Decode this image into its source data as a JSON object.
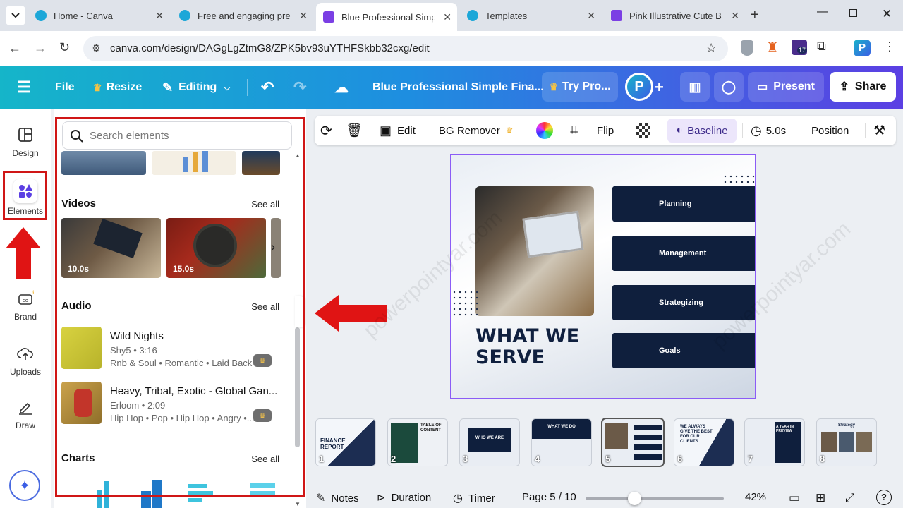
{
  "browser": {
    "tabs": [
      {
        "title": "Home - Canva",
        "active": false
      },
      {
        "title": "Free and engaging prese",
        "active": false
      },
      {
        "title": "Blue Professional Simple",
        "active": true
      },
      {
        "title": "Templates",
        "active": false
      },
      {
        "title": "Pink Illustrative Cute Bra",
        "active": false
      }
    ],
    "url": "canva.com/design/DAGgLgZtmG8/ZPK5bv93uYTHFSkbb32cxg/edit",
    "extension_badge": "17"
  },
  "header": {
    "file_label": "File",
    "resize_label": "Resize",
    "editing_label": "Editing",
    "doc_title": "Blue Professional Simple Fina...",
    "try_pro_label": "Try Pro...",
    "present_label": "Present",
    "share_label": "Share"
  },
  "rail": {
    "items": [
      {
        "label": "Design",
        "icon": "design-icon"
      },
      {
        "label": "Elements",
        "icon": "elements-icon"
      },
      {
        "label": "Brand",
        "icon": "brand-icon"
      },
      {
        "label": "Uploads",
        "icon": "uploads-icon"
      },
      {
        "label": "Draw",
        "icon": "draw-icon"
      }
    ]
  },
  "panel": {
    "search_placeholder": "Search elements",
    "videos": {
      "heading": "Videos",
      "see_all": "See all",
      "items": [
        {
          "duration": "10.0s"
        },
        {
          "duration": "15.0s"
        }
      ]
    },
    "audio": {
      "heading": "Audio",
      "see_all": "See all",
      "items": [
        {
          "title": "Wild Nights",
          "artist": "Shy5 • 3:16",
          "tags": "Rnb & Soul • Romantic • Laid Back"
        },
        {
          "title": "Heavy, Tribal, Exotic - Global Gan...",
          "artist": "Erloom • 2:09",
          "tags": "Hip Hop • Pop • Hip Hop • Angry •..."
        }
      ]
    },
    "charts": {
      "heading": "Charts",
      "see_all": "See all"
    }
  },
  "toolbar": {
    "edit_label": "Edit",
    "bg_remover_label": "BG Remover",
    "flip_label": "Flip",
    "baseline_label": "Baseline",
    "duration_label": "5.0s",
    "position_label": "Position"
  },
  "slide": {
    "heading_line1": "WHAT WE",
    "heading_line2": "SERVE",
    "services": [
      "Planning",
      "Management",
      "Strategizing",
      "Goals"
    ]
  },
  "pages": [
    {
      "num": "1",
      "text": "FINANCE REPORT"
    },
    {
      "num": "2",
      "text": "TABLE OF CONTENT"
    },
    {
      "num": "3",
      "text": "WHO WE ARE"
    },
    {
      "num": "4",
      "text": "WHAT WE DO"
    },
    {
      "num": "5",
      "text": ""
    },
    {
      "num": "6",
      "text": "WE ALWAYS GIVE THE BEST FOR OUR CLIENTS"
    },
    {
      "num": "7",
      "text": "A YEAR IN PREVIEW"
    },
    {
      "num": "8",
      "text": "Strategy"
    }
  ],
  "footer": {
    "notes_label": "Notes",
    "duration_label": "Duration",
    "timer_label": "Timer",
    "page_label": "Page 5 / 10",
    "zoom_label": "42%",
    "zoom_level": 0.42
  },
  "watermark": "powerpointyar.com",
  "colors": {
    "accent_red": "#d01616",
    "selection_purple": "#8b5cf6",
    "slide_navy": "#0f1f3d"
  }
}
